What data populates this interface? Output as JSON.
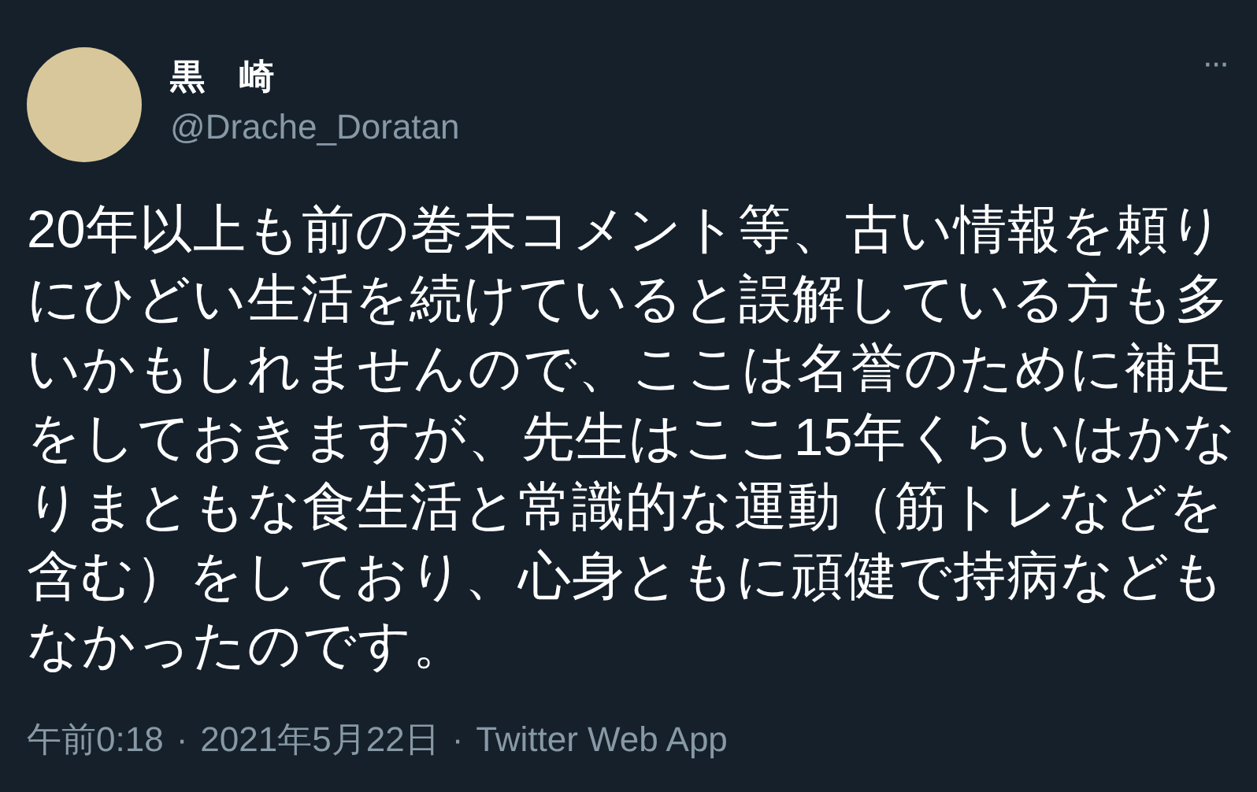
{
  "author": {
    "name": "黒　崎",
    "handle": "@Drache_Doratan"
  },
  "more": "···",
  "body": "20年以上も前の巻末コメント等、古い情報を頼りにひどい生活を続けていると誤解している方も多いかもしれませんので、ここは名誉のために補足をしておきますが、先生はここ15年くらいはかなりまともな食生活と常識的な運動（筋トレなどを含む）をしており、心身ともに頑健で持病などもなかったのです。",
  "meta": {
    "time": "午前0:18",
    "date": "2021年5月22日",
    "source": "Twitter Web App",
    "separator": "·"
  }
}
